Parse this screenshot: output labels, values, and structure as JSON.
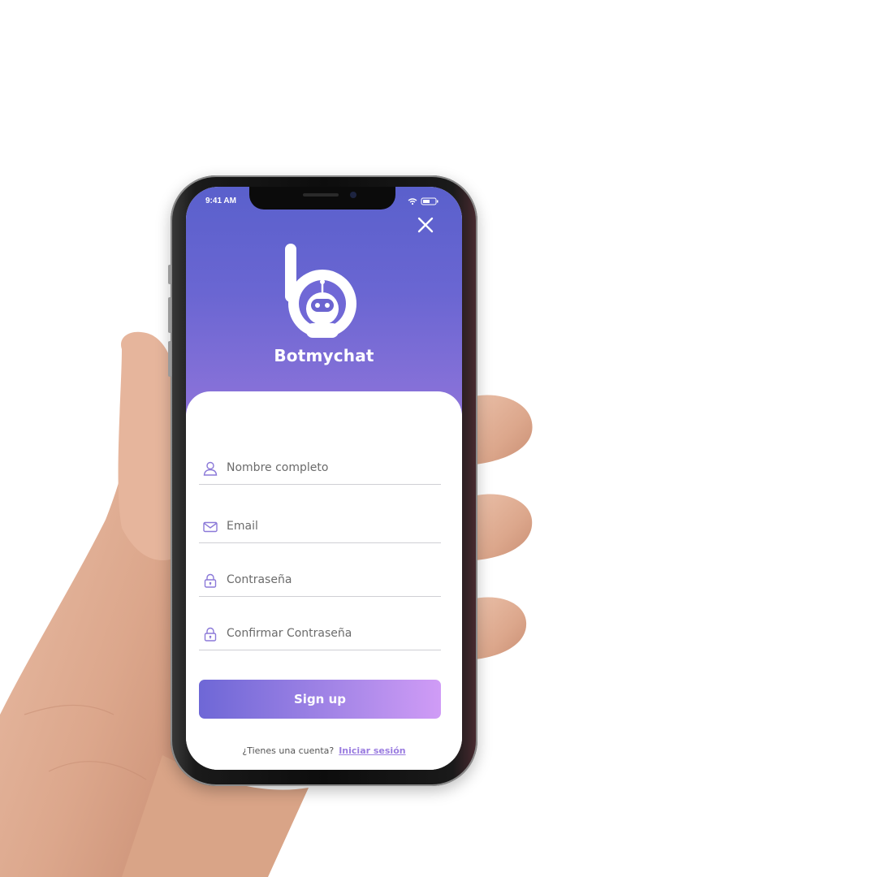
{
  "status_bar": {
    "time": "9:41 AM"
  },
  "header": {
    "brand_name": "Botmychat"
  },
  "icons": {
    "close": "close-icon",
    "user": "user-icon",
    "email": "mail-icon",
    "password": "lock-icon",
    "confirm_password": "lock-icon",
    "logo": "botmychat-logo"
  },
  "form": {
    "full_name": {
      "placeholder": "Nombre completo",
      "value": ""
    },
    "email": {
      "placeholder": "Email",
      "value": ""
    },
    "password": {
      "placeholder": "Contraseña",
      "value": ""
    },
    "confirm_password": {
      "placeholder": "Confirmar Contraseña",
      "value": ""
    },
    "submit_label": "Sign up"
  },
  "footer": {
    "prompt": "¿Tienes una cuenta?",
    "link_label": "Iniciar sesión"
  },
  "colors": {
    "primary": "#6a66d2",
    "accent": "#9a7ce0",
    "button_gradient_start": "#6e67d6",
    "button_gradient_end": "#d09cf6"
  }
}
